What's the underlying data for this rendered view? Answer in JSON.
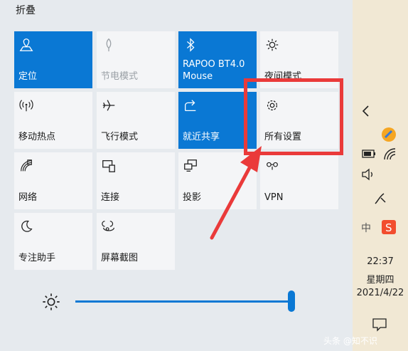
{
  "panel": {
    "collapse_label": "折叠",
    "tiles": [
      {
        "label": "定位",
        "icon": "location-icon",
        "state": "active"
      },
      {
        "label": "节电模式",
        "icon": "leaf-icon",
        "state": "disabled"
      },
      {
        "label": "RAPOO BT4.0 Mouse",
        "icon": "bluetooth-icon",
        "state": "active"
      },
      {
        "label": "夜间模式",
        "icon": "night-light-icon",
        "state": "normal"
      },
      {
        "label": "移动热点",
        "icon": "hotspot-icon",
        "state": "normal"
      },
      {
        "label": "飞行模式",
        "icon": "airplane-icon",
        "state": "normal"
      },
      {
        "label": "就近共享",
        "icon": "nearby-share-icon",
        "state": "active"
      },
      {
        "label": "所有设置",
        "icon": "gear-icon",
        "state": "normal"
      },
      {
        "label": "网络",
        "icon": "network-icon",
        "state": "normal"
      },
      {
        "label": "连接",
        "icon": "connect-icon",
        "state": "normal"
      },
      {
        "label": "投影",
        "icon": "project-icon",
        "state": "normal"
      },
      {
        "label": "VPN",
        "icon": "vpn-icon",
        "state": "normal"
      },
      {
        "label": "专注助手",
        "icon": "moon-icon",
        "state": "normal"
      },
      {
        "label": "屏幕截图",
        "icon": "screen-snip-icon",
        "state": "normal"
      }
    ],
    "brightness": {
      "icon": "brightness-icon",
      "level": 1.0
    }
  },
  "taskbar": {
    "time": "22:37",
    "weekday": "星期四",
    "date": "2021/4/22",
    "ime_label": "中"
  },
  "watermark": "头条 @知不识",
  "colors": {
    "accent": "#0a78d4",
    "highlight": "#ea3a3a",
    "taskbar": "#f1e8d4"
  }
}
